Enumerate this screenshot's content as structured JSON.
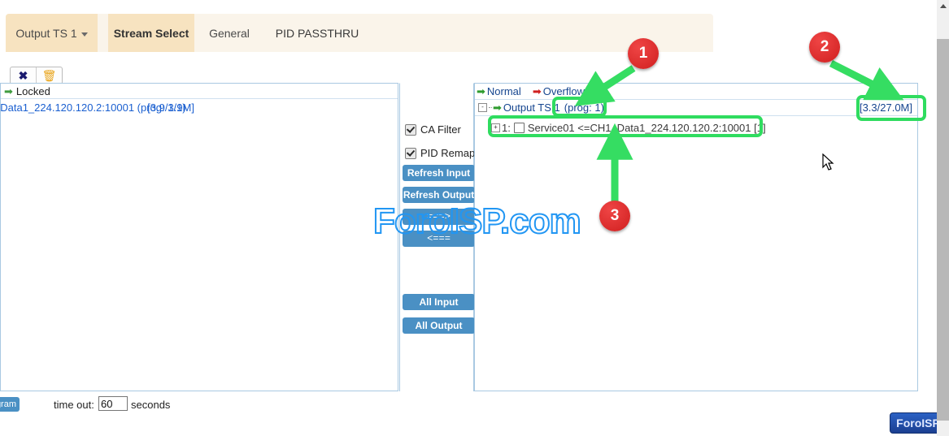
{
  "tabs": [
    {
      "label": "Output TS 1",
      "name": "tab-output-ts-1",
      "has_caret": true
    },
    {
      "label": "Stream Select",
      "name": "tab-stream-select",
      "active": true
    },
    {
      "label": "General",
      "name": "tab-general"
    },
    {
      "label": "PID PASSTHRU",
      "name": "tab-pid-passthru"
    }
  ],
  "toolbar": {
    "delete_icon": "✖",
    "trash_icon": "🗑",
    "delete_icon_name": "close-x-icon",
    "trash_icon_name": "trash-icon"
  },
  "left_panel": {
    "locked_label": "Locked",
    "locked_arrow": "➡",
    "input_row": {
      "label": "_Data1_224.120.120.2:10001 (prog: 1/1)",
      "rate": "[3.9/3.9M]"
    }
  },
  "center_panel": {
    "checkboxes": [
      {
        "label": "CA Filter",
        "checked": true,
        "name": "ca-filter-checkbox"
      },
      {
        "label": "PID Remap",
        "checked": true,
        "name": "pid-remap-checkbox"
      }
    ],
    "buttons": [
      {
        "label": "Refresh Input",
        "name": "refresh-input-button"
      },
      {
        "label": "Refresh Output",
        "name": "refresh-output-button"
      },
      {
        "label": "===>",
        "name": "move-right-button"
      },
      {
        "label": "<===",
        "name": "move-left-button"
      },
      {
        "label": "All Input",
        "name": "all-input-button"
      },
      {
        "label": "All Output",
        "name": "all-output-button"
      }
    ]
  },
  "right_panel": {
    "legend": {
      "normal_label": "Normal",
      "normal_arrow": "➡",
      "overflow_label": "Overflow",
      "overflow_arrow": "➡"
    },
    "output_node": {
      "expander": "-",
      "arrow": "➡",
      "label": "Output TS 1",
      "prog": "(prog: 1)",
      "rate": "[3.3/27.0M]"
    },
    "service_node": {
      "expander": "+",
      "index": "1:",
      "label": "Service01 <=CH1_Data1_224.120.120.2:10001 [1]"
    }
  },
  "bottom_bar": {
    "program_button": "gram",
    "timeout_label": "time out:",
    "timeout_value": "60",
    "seconds_label": "seconds"
  },
  "watermark": {
    "text": "ForoISP.com"
  },
  "brand_button": {
    "label": "ForoISP"
  },
  "annotations": {
    "badges": [
      {
        "number": "1",
        "name": "annotation-badge-1"
      },
      {
        "number": "2",
        "name": "annotation-badge-2"
      },
      {
        "number": "3",
        "name": "annotation-badge-3"
      }
    ],
    "highlight_color": "#2fdc5f",
    "badge_color": "#d01f1f"
  }
}
